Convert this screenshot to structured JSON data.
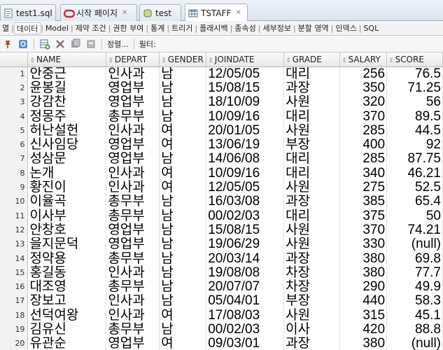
{
  "editor_tabs": [
    {
      "label": "test1.sql",
      "icon": "sql-file-icon"
    },
    {
      "label": "시작 페이지",
      "icon": "oracle-icon"
    },
    {
      "label": "test",
      "icon": "database-connection-icon"
    },
    {
      "label": "TSTAFF",
      "icon": "table-icon"
    }
  ],
  "sub_tabs": [
    "열",
    "데이터",
    "Model",
    "제약 조건",
    "권한 부여",
    "통계",
    "트리거",
    "플래시백",
    "종속성",
    "세부정보",
    "분할 영역",
    "인덱스",
    "SQL"
  ],
  "toolbar": {
    "sort_label": "정렬...",
    "filter_label": "필터:"
  },
  "grid": {
    "columns": [
      "NAME",
      "DEPART",
      "GENDER",
      "JOINDATE",
      "GRADE",
      "SALARY",
      "SCORE"
    ],
    "rows": [
      {
        "n": "1",
        "name": "안중근",
        "depart": "인사과",
        "gender": "남",
        "joindate": "12/05/05",
        "grade": "대리",
        "salary": "256",
        "score": "76.5"
      },
      {
        "n": "2",
        "name": "윤봉길",
        "depart": "영업부",
        "gender": "남",
        "joindate": "15/08/15",
        "grade": "과장",
        "salary": "350",
        "score": "71.25"
      },
      {
        "n": "3",
        "name": "강감찬",
        "depart": "영업부",
        "gender": "남",
        "joindate": "18/10/09",
        "grade": "사원",
        "salary": "320",
        "score": "56"
      },
      {
        "n": "4",
        "name": "정몽주",
        "depart": "총무부",
        "gender": "남",
        "joindate": "10/09/16",
        "grade": "대리",
        "salary": "370",
        "score": "89.5"
      },
      {
        "n": "5",
        "name": "허난설헌",
        "depart": "인사과",
        "gender": "여",
        "joindate": "20/01/05",
        "grade": "사원",
        "salary": "285",
        "score": "44.5"
      },
      {
        "n": "6",
        "name": "신사임당",
        "depart": "영업부",
        "gender": "여",
        "joindate": "13/06/19",
        "grade": "부장",
        "salary": "400",
        "score": "92"
      },
      {
        "n": "7",
        "name": "성삼문",
        "depart": "영업부",
        "gender": "남",
        "joindate": "14/06/08",
        "grade": "대리",
        "salary": "285",
        "score": "87.75"
      },
      {
        "n": "8",
        "name": "논개",
        "depart": "인사과",
        "gender": "여",
        "joindate": "10/09/16",
        "grade": "대리",
        "salary": "340",
        "score": "46.21"
      },
      {
        "n": "9",
        "name": "황진이",
        "depart": "인사과",
        "gender": "여",
        "joindate": "12/05/05",
        "grade": "사원",
        "salary": "275",
        "score": "52.5"
      },
      {
        "n": "10",
        "name": "이율곡",
        "depart": "총무부",
        "gender": "남",
        "joindate": "16/03/08",
        "grade": "과장",
        "salary": "385",
        "score": "65.4"
      },
      {
        "n": "11",
        "name": "이사부",
        "depart": "총무부",
        "gender": "남",
        "joindate": "00/02/03",
        "grade": "대리",
        "salary": "375",
        "score": "50"
      },
      {
        "n": "12",
        "name": "안창호",
        "depart": "영업부",
        "gender": "남",
        "joindate": "15/08/15",
        "grade": "사원",
        "salary": "370",
        "score": "74.21"
      },
      {
        "n": "13",
        "name": "을지문덕",
        "depart": "영업부",
        "gender": "남",
        "joindate": "19/06/29",
        "grade": "사원",
        "salary": "330",
        "score": "(null)"
      },
      {
        "n": "14",
        "name": "정약용",
        "depart": "총무부",
        "gender": "남",
        "joindate": "20/03/14",
        "grade": "과장",
        "salary": "380",
        "score": "69.8"
      },
      {
        "n": "15",
        "name": "홍길동",
        "depart": "인사과",
        "gender": "남",
        "joindate": "19/08/08",
        "grade": "차장",
        "salary": "380",
        "score": "77.7"
      },
      {
        "n": "16",
        "name": "대조영",
        "depart": "총무부",
        "gender": "남",
        "joindate": "20/07/07",
        "grade": "차장",
        "salary": "290",
        "score": "49.9"
      },
      {
        "n": "17",
        "name": "장보고",
        "depart": "인사과",
        "gender": "남",
        "joindate": "05/04/01",
        "grade": "부장",
        "salary": "440",
        "score": "58.3"
      },
      {
        "n": "18",
        "name": "선덕여왕",
        "depart": "인사과",
        "gender": "여",
        "joindate": "17/08/03",
        "grade": "사원",
        "salary": "315",
        "score": "45.1"
      },
      {
        "n": "19",
        "name": "김유신",
        "depart": "총무부",
        "gender": "남",
        "joindate": "00/02/03",
        "grade": "이사",
        "salary": "420",
        "score": "88.8"
      },
      {
        "n": "20",
        "name": "유관순",
        "depart": "영업부",
        "gender": "여",
        "joindate": "09/03/01",
        "grade": "과장",
        "salary": "380",
        "score": "(null)"
      }
    ]
  },
  "colors": {
    "tab_bar_bg": "#dce4ee",
    "header_bg": "#e8e8e8",
    "oracle_red": "#d2232a"
  }
}
